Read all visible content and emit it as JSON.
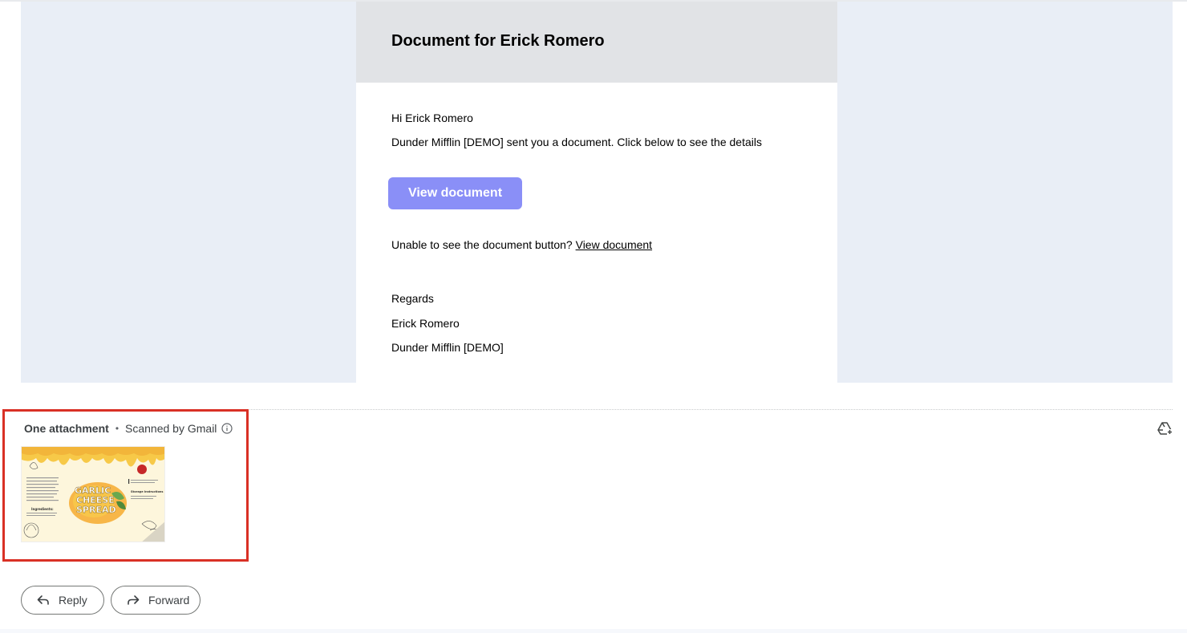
{
  "email": {
    "title": "Document for Erick Romero",
    "greeting": "Hi Erick Romero",
    "intro": "Dunder Mifflin [DEMO] sent you a document. Click below to see the details",
    "button_label": "View document",
    "fallback_text": "Unable to see the document button?",
    "fallback_link": "View document",
    "regards": "Regards",
    "signature_name": "Erick Romero",
    "signature_company": "Dunder Mifflin [DEMO]"
  },
  "attachments": {
    "count_label": "One attachment",
    "separator": "•",
    "scan_label": "Scanned by Gmail",
    "info_icon": "info-icon",
    "drive_icon": "add-to-drive-icon",
    "thumbnail": {
      "art_title_lines": [
        "GARLIC",
        "CHEESE",
        "SPREAD"
      ],
      "ingredients_heading": "Ingredients:",
      "storage_heading": "Storage Instructions"
    },
    "highlight_color": "#d93025"
  },
  "actions": {
    "reply_label": "Reply",
    "forward_label": "Forward",
    "reply_icon": "reply-arrow-icon",
    "forward_icon": "forward-arrow-icon"
  },
  "colors": {
    "button_bg": "#8a8ff7",
    "email_bg": "#e9eef6",
    "header_bg": "#e1e3e6"
  }
}
